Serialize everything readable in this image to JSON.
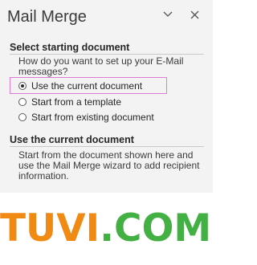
{
  "pane": {
    "title": "Mail Merge",
    "options_icon": "chevron-down-icon",
    "close_icon": "close-icon"
  },
  "starting": {
    "heading": "Select starting document",
    "question": "How do you want to set up your E-Mail messages?",
    "options": [
      {
        "label": "Use the current document",
        "selected": true
      },
      {
        "label": "Start from a template",
        "selected": false
      },
      {
        "label": "Start from existing document",
        "selected": false
      }
    ]
  },
  "current": {
    "heading": "Use the current document",
    "description": "Start from the document shown here and use the Mail Merge wizard to add recipient information."
  },
  "watermark": {
    "part1": "TUVI",
    "part2": ".COM",
    "color1": "#f08a12",
    "color2": "#43b043"
  },
  "colors": {
    "highlight": "#e07ad9",
    "pane_bg": "#f3f3f3"
  }
}
